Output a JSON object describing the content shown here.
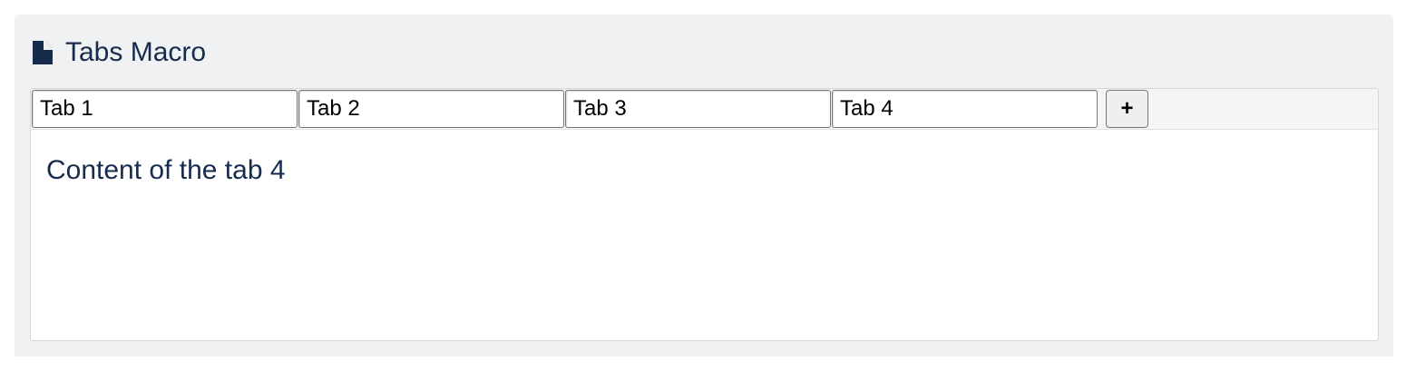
{
  "macro": {
    "icon": "document-icon",
    "title": "Tabs Macro"
  },
  "tabs": [
    {
      "label": "Tab 1"
    },
    {
      "label": "Tab 2"
    },
    {
      "label": "Tab 3"
    },
    {
      "label": "Tab 4"
    }
  ],
  "add_tab_label": "+",
  "active_tab_content": "Content of the tab 4",
  "colors": {
    "panel_background": "#f0f1f3",
    "title_text": "#172b4d",
    "content_text": "#172b4d"
  }
}
